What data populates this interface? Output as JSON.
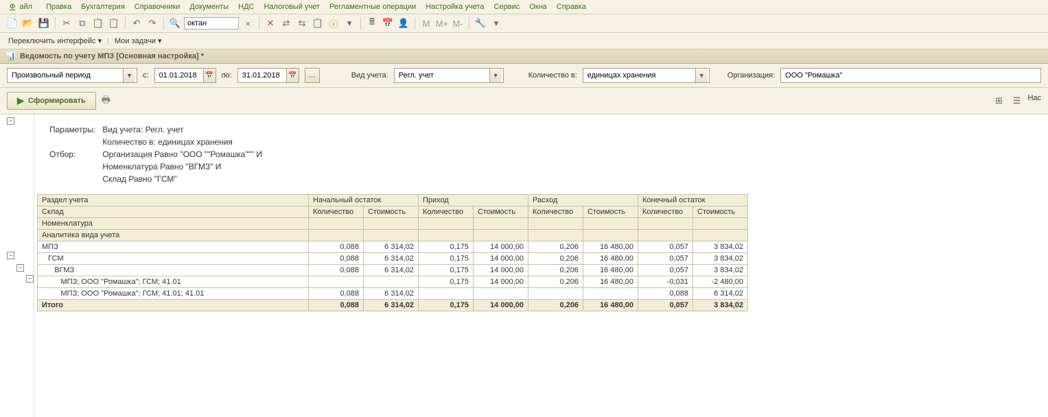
{
  "menu": {
    "file": "Файл",
    "edit": "Правка",
    "accounting": "Бухгалтерия",
    "directories": "Справочники",
    "documents": "Документы",
    "nds": "НДС",
    "taxacct": "Налоговый учет",
    "regops": "Регламентные операции",
    "setupacct": "Настройка учета",
    "service": "Сервис",
    "windows": "Окна",
    "help": "Справка"
  },
  "toolbar": {
    "search_value": "октан"
  },
  "toolbar2": {
    "switch_ui": "Переключить интерфейс",
    "my_tasks": "Мои задачи"
  },
  "title": "Ведомость по учету МПЗ [Основная настройка] *",
  "filters": {
    "period_type": "Произвольный период",
    "from_lbl": "с:",
    "from": "01.01.2018",
    "to_lbl": "по:",
    "to": "31.01.2018",
    "acct_type_lbl": "Вид учета:",
    "acct_type": "Регл. учет",
    "qty_in_lbl": "Количество в:",
    "qty_in": "единицах хранения",
    "org_lbl": "Организация:",
    "org": "ООО \"Ромашка\""
  },
  "actions": {
    "run": "Сформировать",
    "nas": "Нас"
  },
  "params": {
    "params_lbl": "Параметры:",
    "p1": "Вид учета: Регл. учет",
    "p2": "Количество в: единицах хранения",
    "filter_lbl": "Отбор:",
    "f1": "Организация Равно \"ООО \"\"Ромашка\"\"\" И",
    "f2": "Номенклатура Равно \"ВГМЗ\" И",
    "f3": "Склад Равно \"ГСМ\""
  },
  "headers": {
    "section": "Раздел учета",
    "warehouse": "Склад",
    "nomen": "Номенклатура",
    "analytics": "Аналитика вида учета",
    "begin": "Начальный остаток",
    "income": "Приход",
    "expense": "Расход",
    "end": "Конечный остаток",
    "qty": "Количество",
    "cost": "Стоимость"
  },
  "rows": [
    {
      "label": "МПЗ",
      "bq": "0,088",
      "bc": "6 314,02",
      "iq": "0,175",
      "ic": "14 000,00",
      "eq": "0,206",
      "ec": "16 480,00",
      "nq": "0,057",
      "nc": "3 834,02"
    },
    {
      "label": "   ГСМ",
      "bq": "0,088",
      "bc": "6 314,02",
      "iq": "0,175",
      "ic": "14 000,00",
      "eq": "0,206",
      "ec": "16 480,00",
      "nq": "0,057",
      "nc": "3 834,02"
    },
    {
      "label": "      ВГМЗ",
      "bq": "0,088",
      "bc": "6 314,02",
      "iq": "0,175",
      "ic": "14 000,00",
      "eq": "0,206",
      "ec": "16 480,00",
      "nq": "0,057",
      "nc": "3 834,02"
    },
    {
      "label": "         МПЗ; ООО \"Ромашка\"; ГСМ; 41.01",
      "bq": "",
      "bc": "",
      "iq": "0,175",
      "ic": "14 000,00",
      "eq": "0,206",
      "ec": "16 480,00",
      "nq": "-0,031",
      "nc": "-2 480,00"
    },
    {
      "label": "         МПЗ; ООО \"Ромашка\"; ГСМ; 41.01; 41.01",
      "bq": "0,088",
      "bc": "6 314,02",
      "iq": "",
      "ic": "",
      "eq": "",
      "ec": "",
      "nq": "0,088",
      "nc": "6 314,02"
    }
  ],
  "total": {
    "label": "Итого",
    "bq": "0,088",
    "bc": "6 314,02",
    "iq": "0,175",
    "ic": "14 000,00",
    "eq": "0,206",
    "ec": "16 480,00",
    "nq": "0,057",
    "nc": "3 834,02"
  }
}
